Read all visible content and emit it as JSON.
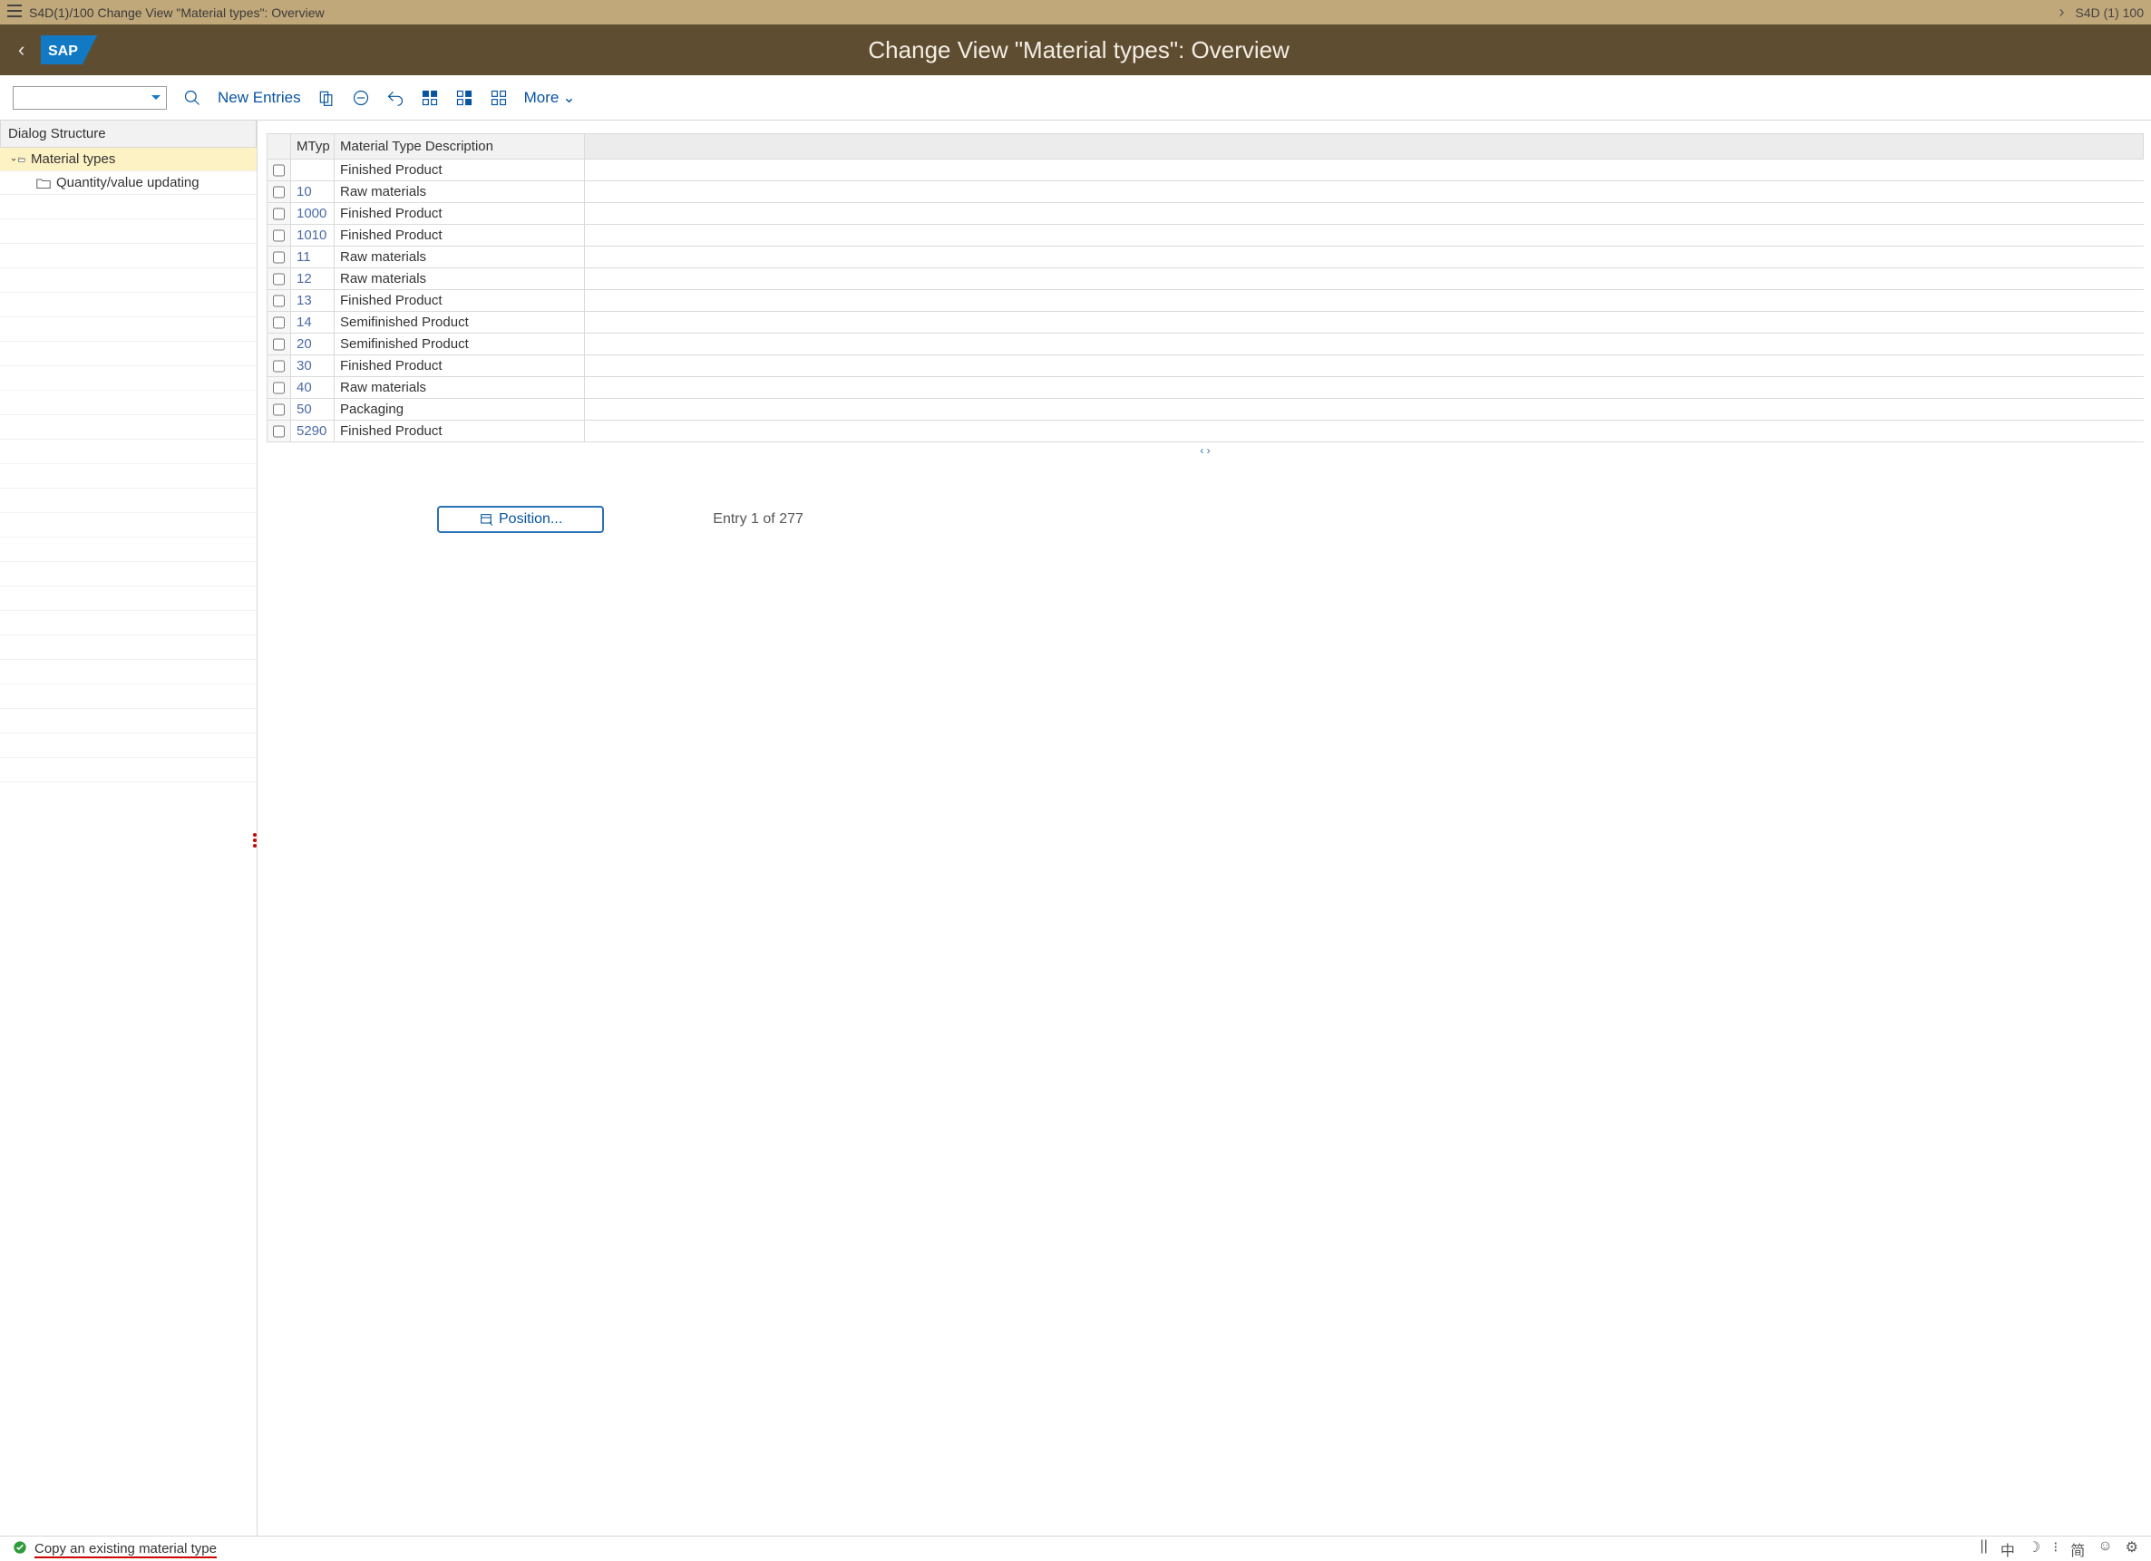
{
  "titlebar": {
    "window_title": "S4D(1)/100 Change View \"Material types\": Overview",
    "right_label": "S4D (1) 100"
  },
  "header": {
    "page_title": "Change View \"Material types\": Overview"
  },
  "toolbar": {
    "new_entries": "New Entries",
    "more": "More"
  },
  "tree": {
    "header": "Dialog Structure",
    "items": [
      {
        "label": "Material types",
        "level": 0,
        "type": "expanded"
      },
      {
        "label": "Quantity/value updating",
        "level": 1,
        "type": "folder"
      }
    ]
  },
  "grid": {
    "columns": {
      "sel": "",
      "mtyp": "MTyp",
      "desc": "Material Type Description"
    },
    "rows": [
      {
        "mtyp": "",
        "desc": "Finished Product"
      },
      {
        "mtyp": "10",
        "desc": "Raw materials"
      },
      {
        "mtyp": "1000",
        "desc": "Finished Product"
      },
      {
        "mtyp": "1010",
        "desc": "Finished Product"
      },
      {
        "mtyp": "11",
        "desc": "Raw materials"
      },
      {
        "mtyp": "12",
        "desc": "Raw materials"
      },
      {
        "mtyp": "13",
        "desc": "Finished Product"
      },
      {
        "mtyp": "14",
        "desc": "Semifinished Product"
      },
      {
        "mtyp": "20",
        "desc": "Semifinished Product"
      },
      {
        "mtyp": "30",
        "desc": "Finished Product"
      },
      {
        "mtyp": "40",
        "desc": "Raw materials"
      },
      {
        "mtyp": "50",
        "desc": "Packaging"
      },
      {
        "mtyp": "5290",
        "desc": "Finished Product"
      }
    ]
  },
  "position_button": "Position...",
  "entry_info": "Entry 1 of 277",
  "status": {
    "message": "Copy an existing material type"
  }
}
